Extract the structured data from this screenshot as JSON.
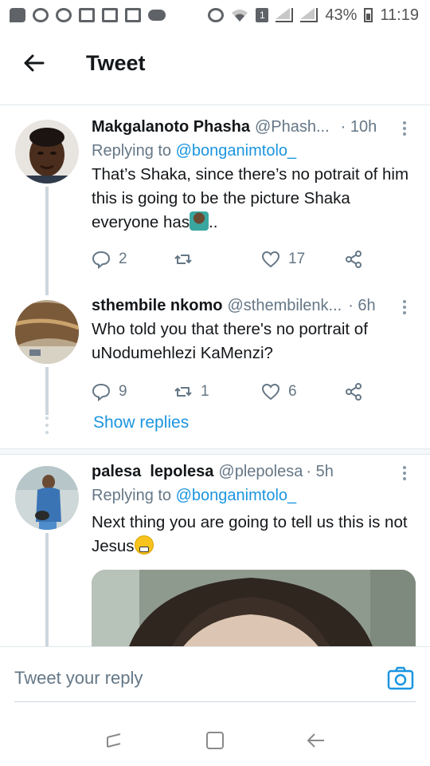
{
  "status_bar": {
    "battery": "43%",
    "time": "11:19",
    "sim": "1"
  },
  "header": {
    "title": "Tweet"
  },
  "tweets": [
    {
      "name": "Makgalanoto Phasha",
      "handle": "@Phash...",
      "time": "· 10h",
      "replying_prefix": "Replying to ",
      "replying_to": "@bonganimtolo_",
      "text": "That’s Shaka, since there’s no potrait of him this is going to be the picture Shaka everyone has",
      "text_suffix": "..",
      "replies": "2",
      "retweets": "",
      "likes": "17"
    },
    {
      "name": "sthembile nkomo",
      "handle": "@sthembilenk...",
      "time": "· 6h",
      "text": "Who told you that there's no portrait of uNodumehlezi KaMenzi?",
      "replies": "9",
      "retweets": "1",
      "likes": "6"
    },
    {
      "name": "palesa  lepolesa",
      "handle": "@plepolesa",
      "time": "· 5h",
      "replying_prefix": "Replying to ",
      "replying_to": "@bonganimtolo_",
      "text": "Next thing you are going to tell us this is not Jesus"
    }
  ],
  "show_replies": "Show replies",
  "reply_bar": {
    "placeholder": "Tweet your reply"
  },
  "icons": {
    "back": "arrow-left-icon",
    "camera": "camera-icon",
    "reply": "reply-icon",
    "retweet": "retweet-icon",
    "like": "heart-icon",
    "share": "share-icon"
  },
  "colors": {
    "accent": "#1b95e0",
    "secondary_text": "#657786"
  }
}
